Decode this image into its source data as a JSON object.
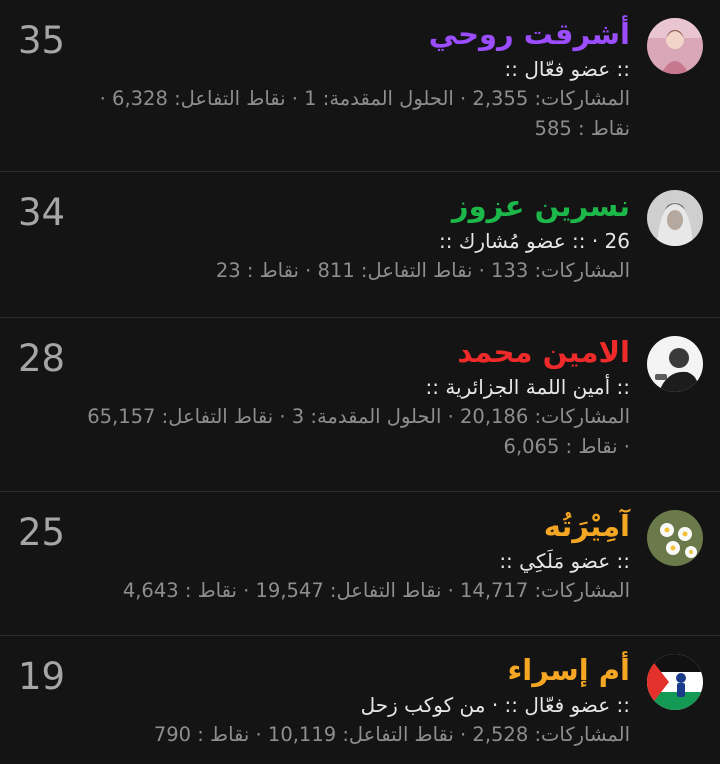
{
  "members": [
    {
      "score": "35",
      "name": "أشرقت روحي",
      "name_color": "#9b4dff",
      "avatar_icon": "avatar-photo-girl-pink",
      "title": ":: عضو فعّال ::",
      "stats_line1": "المشاركات: 2,355 · الحلول المقدمة: 1 · نقاط التفاعل: 6,328 ·",
      "stats_line2": "نقاط : 585"
    },
    {
      "score": "34",
      "name": "نسرين عزوز",
      "name_color": "#1db84a",
      "avatar_icon": "avatar-photo-woman-grey",
      "title": "26 · :: عضو مُشارك ::",
      "stats_line1": "المشاركات: 133 · نقاط التفاعل: 811 · نقاط : 23",
      "stats_line2": ""
    },
    {
      "score": "28",
      "name": "الامين محمد",
      "name_color": "#ee2a2a",
      "avatar_icon": "avatar-photo-man-white",
      "title": ":: أمين اللمة الجزائرية ::",
      "stats_line1": "المشاركات: 20,186 · الحلول المقدمة: 3 · نقاط التفاعل: 65,157",
      "stats_line2": "· نقاط : 6,065"
    },
    {
      "score": "25",
      "name": "آمِيْرَتُه",
      "name_color": "#f5a623",
      "avatar_icon": "avatar-photo-flowers",
      "title": ":: عضو مَلَكِي ::",
      "stats_line1": "المشاركات: 14,717 · نقاط التفاعل: 19,547 · نقاط : 4,643",
      "stats_line2": ""
    },
    {
      "score": "19",
      "name": "أم إسراء",
      "name_color": "#f5a623",
      "avatar_icon": "avatar-palestine-flag",
      "title": ":: عضو فعّال :: · من كوكب زحل",
      "stats_line1": "المشاركات: 2,528 · نقاط التفاعل: 10,119 · نقاط : 790",
      "stats_line2": ""
    }
  ]
}
